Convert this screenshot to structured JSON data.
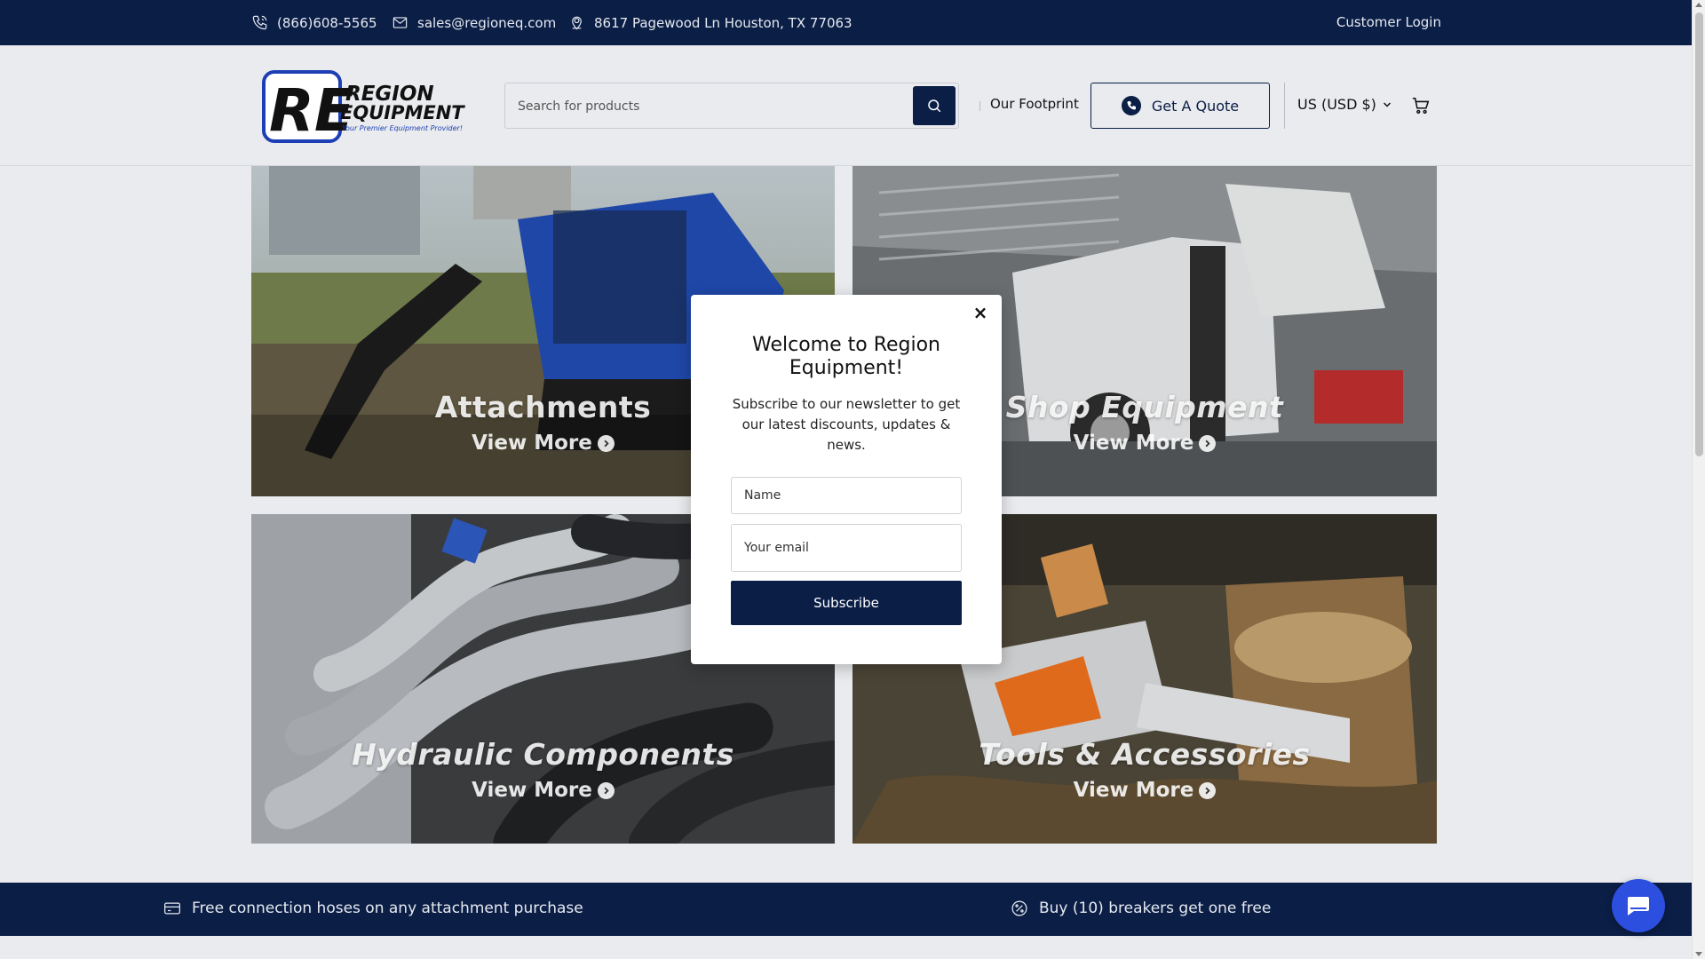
{
  "topbar": {
    "phone": "(866)608-5565",
    "email": "sales@regioneq.com",
    "address": "8617 Pagewood Ln Houston, TX 77063",
    "login": "Customer Login"
  },
  "header": {
    "logo_monogram": "RE",
    "logo_line1": "REGION",
    "logo_line2": "EQUIPMENT",
    "logo_tagline": "Your Premier Equipment Provider!",
    "search_placeholder": "Search for products",
    "footprint": "Our Footprint",
    "quote": "Get A Quote",
    "currency": "US (USD $)"
  },
  "tiles": [
    {
      "title": "Attachments",
      "more": "View More"
    },
    {
      "title": "Shop Equipment",
      "more": "View More"
    },
    {
      "title": "Hydraulic Components",
      "more": "View More"
    },
    {
      "title": "Tools & Accessories",
      "more": "View More"
    }
  ],
  "modal": {
    "title": "Welcome to Region Equipment!",
    "body": "Subscribe to our newsletter to get our latest discounts, updates & news.",
    "name_placeholder": "Name",
    "email_placeholder": "Your email",
    "subscribe": "Subscribe",
    "close": "×"
  },
  "announcements": [
    {
      "text": "Free connection hoses on any attachment purchase",
      "icon": "card-icon"
    },
    {
      "text": "Buy (10) breakers get one free",
      "icon": "percent-badge-icon"
    }
  ],
  "colors": {
    "navy": "#0b1e46",
    "page_bg": "#e9ebee",
    "logo_blue": "#1d3fb5",
    "chat_blue": "#2d4fe0"
  }
}
